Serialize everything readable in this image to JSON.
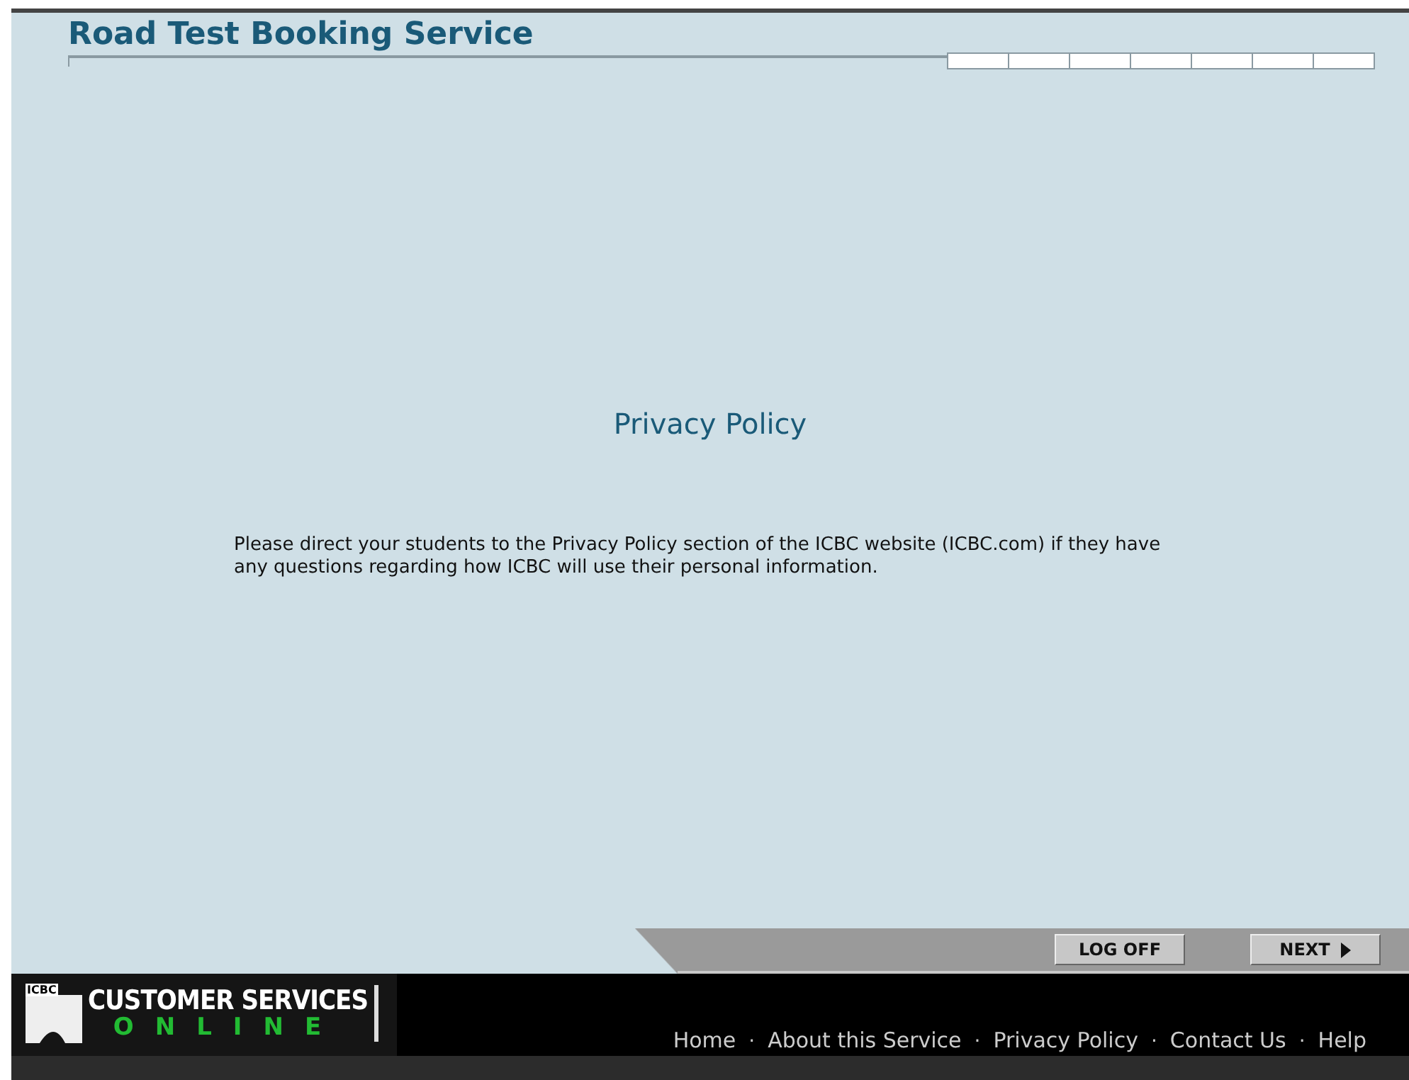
{
  "header": {
    "title": "Road Test Booking Service"
  },
  "content": {
    "heading": "Privacy Policy",
    "paragraph": "Please direct your students to the Privacy Policy section of the ICBC website (ICBC.com) if they have any questions regarding how ICBC will use their personal information."
  },
  "actions": [
    {
      "label": "LOG OFF",
      "kind": "plain"
    },
    {
      "label": "NEXT",
      "kind": "forward"
    }
  ],
  "logo": {
    "badge": "ICBC",
    "title": "CUSTOMER SERVICES",
    "subtitle": "ONLINE"
  },
  "footer_links": [
    "Home",
    "About this Service",
    "Privacy Policy",
    "Contact Us",
    "Help"
  ],
  "footer_separator": "·"
}
